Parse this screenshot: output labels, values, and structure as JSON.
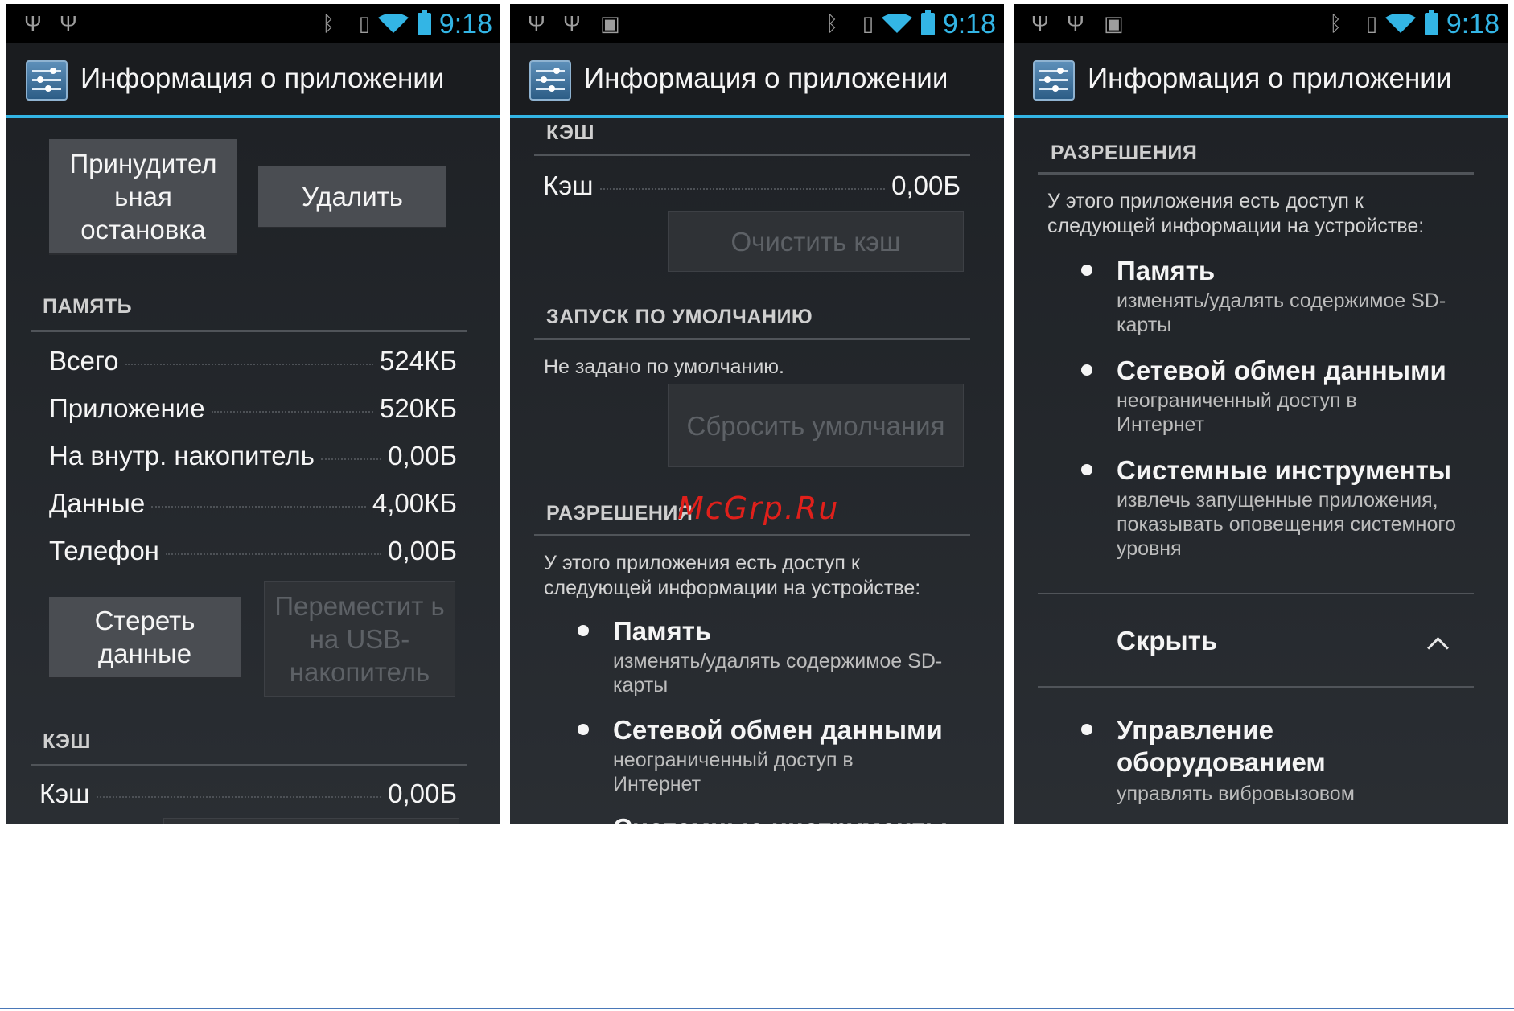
{
  "status_bar": {
    "time": "9:18"
  },
  "action_bar": {
    "title": "Информация о приложении"
  },
  "screen1": {
    "force_stop_button": "Принудител ьная остановка",
    "uninstall_button": "Удалить",
    "storage_header": "ПАМЯТЬ",
    "storage_rows": [
      {
        "label": "Всего",
        "value": "524КБ"
      },
      {
        "label": "Приложение",
        "value": "520КБ"
      },
      {
        "label": "На внутр. накопитель",
        "value": "0,00Б"
      },
      {
        "label": "Данные",
        "value": "4,00КБ"
      },
      {
        "label": "Телефон",
        "value": "0,00Б"
      }
    ],
    "clear_data_button": "Стереть данные",
    "move_to_usb_button": "Переместит ь на USB- накопитель",
    "cache_header": "КЭШ",
    "cache_row": {
      "label": "Кэш",
      "value": "0,00Б"
    }
  },
  "screen2": {
    "cache_header": "КЭШ",
    "cache_row": {
      "label": "Кэш",
      "value": "0,00Б"
    },
    "clear_cache_button": "Очистить кэш",
    "launch_default_header": "ЗАПУСК ПО УМОЛЧАНИЮ",
    "no_defaults_text": "Не задано по умолчанию.",
    "clear_defaults_button": "Сбросить умолчания",
    "permissions_header": "РАЗРЕШЕНИЯ",
    "permissions_intro": "У этого приложения есть доступ к следующей информации на устройстве:",
    "permissions": [
      {
        "title": "Память",
        "desc": "изменять/удалять содержимое SD-карты"
      },
      {
        "title": "Сетевой обмен данными",
        "desc": "неограниченный доступ в Интернет"
      },
      {
        "title": "Системные инструменты",
        "desc": ""
      }
    ]
  },
  "screen3": {
    "permissions_header": "РАЗРЕШЕНИЯ",
    "permissions_intro": "У этого приложения есть доступ к следующей информации на устройстве:",
    "permissions": [
      {
        "title": "Память",
        "desc": "изменять/удалять содержимое SD-карты"
      },
      {
        "title": "Сетевой обмен данными",
        "desc": "неограниченный доступ в Интернет"
      },
      {
        "title": "Системные инструменты",
        "desc": "извлечь запущенные приложения, показывать оповещения системного уровня"
      }
    ],
    "hide_label": "Скрыть",
    "hidden_permission": {
      "title": "Управление оборудованием",
      "desc": "управлять вибровызовом"
    }
  },
  "watermark": "McGrp.Ru",
  "icons": [
    "usb-icon",
    "image-icon",
    "bluetooth-icon",
    "vibrate-icon",
    "wifi-icon",
    "battery-icon",
    "settings-app-icon",
    "chevron-up-icon"
  ],
  "colors": {
    "accent": "#33b5e5",
    "background": "#1d2024",
    "watermark": "#e0201b"
  }
}
